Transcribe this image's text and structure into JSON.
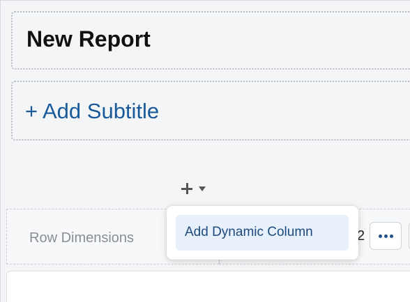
{
  "report": {
    "title": "New Report",
    "add_subtitle_label": "+ Add Subtitle"
  },
  "toolbar": {
    "add_icon": "plus-icon",
    "dropdown_icon": "caret-down-icon"
  },
  "dropdown_menu": {
    "items": [
      {
        "label": "Add Dynamic Column"
      }
    ]
  },
  "table": {
    "row_dimensions_label": "Row Dimensions",
    "column_count_text": "2",
    "more_icon": "more-dots-icon"
  },
  "colors": {
    "subtitle_link": "#1a5a9a",
    "menu_highlight": "#e7f0fb",
    "menu_text": "#1d4a7d"
  }
}
